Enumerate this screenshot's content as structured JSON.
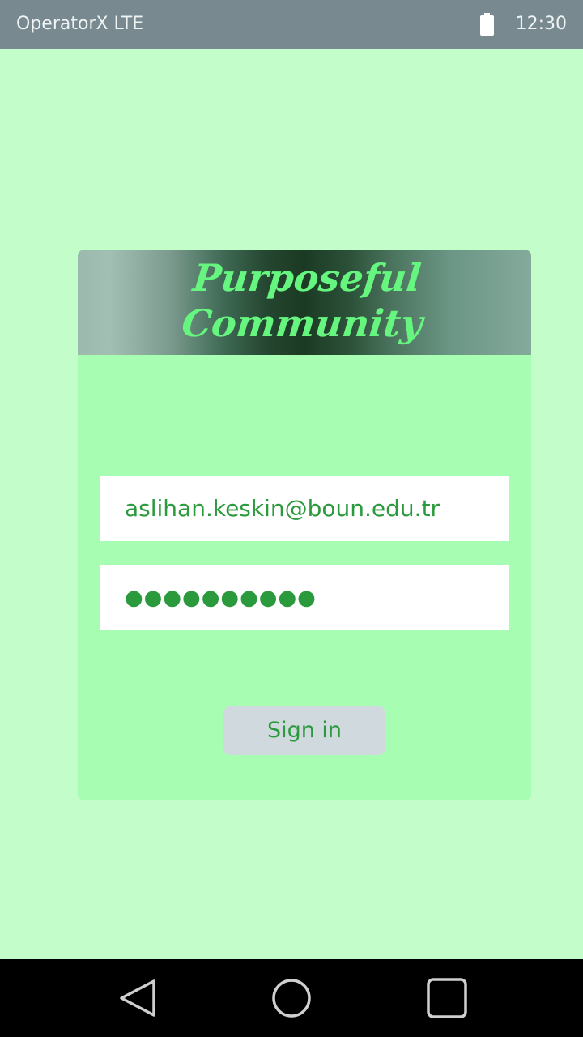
{
  "status_bar": {
    "carrier": "OperatorX LTE",
    "time": "12:30",
    "battery_icon": "battery-full-icon"
  },
  "login_card": {
    "title_line1": "Purposeful",
    "title_line2": "Community",
    "email_value": "aslihan.keskin@boun.edu.tr",
    "password_masked": "●●●●●●●●●●",
    "sign_in_label": "Sign in"
  },
  "nav_bar": {
    "back_icon": "back-triangle-icon",
    "home_icon": "home-circle-icon",
    "recents_icon": "recents-square-icon"
  },
  "colors": {
    "background": "#c3fdca",
    "card": "#a7fdb2",
    "accent_green": "#2b9a3d",
    "title_green": "#66f57f",
    "status_bar": "#788990",
    "button": "#d0d9de"
  }
}
